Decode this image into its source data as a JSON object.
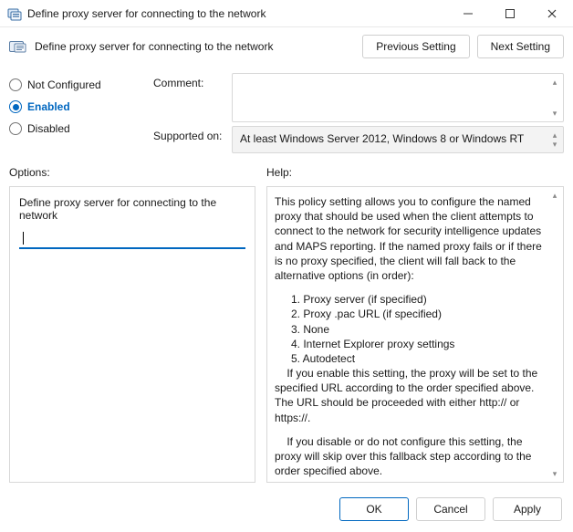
{
  "window": {
    "title": "Define proxy server for connecting to the network"
  },
  "header": {
    "subtitle": "Define proxy server for connecting to the network",
    "previous_label": "Previous Setting",
    "next_label": "Next Setting"
  },
  "state": {
    "radios": {
      "not_configured": "Not Configured",
      "enabled": "Enabled",
      "disabled": "Disabled"
    },
    "selected": "enabled"
  },
  "meta": {
    "comment_label": "Comment:",
    "comment_value": "",
    "supported_label": "Supported on:",
    "supported_value": "At least Windows Server 2012, Windows 8 or Windows RT"
  },
  "panels": {
    "options_label": "Options:",
    "help_label": "Help:",
    "option_field_label": "Define proxy server for connecting to the network",
    "option_field_value": ""
  },
  "help": {
    "intro": "This policy setting allows you to configure the named proxy that should be used when the client attempts to connect to the network for security intelligence updates and MAPS reporting. If the named proxy fails or if there is no proxy specified, the client will fall back to the alternative options (in order):",
    "list": {
      "i1": "1. Proxy server (if specified)",
      "i2": "2. Proxy .pac URL (if specified)",
      "i3": "3. None",
      "i4": "4. Internet Explorer proxy settings",
      "i5": "5. Autodetect"
    },
    "enable": "    If you enable this setting, the proxy will be set to the specified URL according to the order specified above. The URL should be proceeded with either http:// or https://.",
    "disable": "    If you disable or do not configure this setting, the proxy will skip over this fallback step according to the order specified above."
  },
  "footer": {
    "ok": "OK",
    "cancel": "Cancel",
    "apply": "Apply"
  }
}
